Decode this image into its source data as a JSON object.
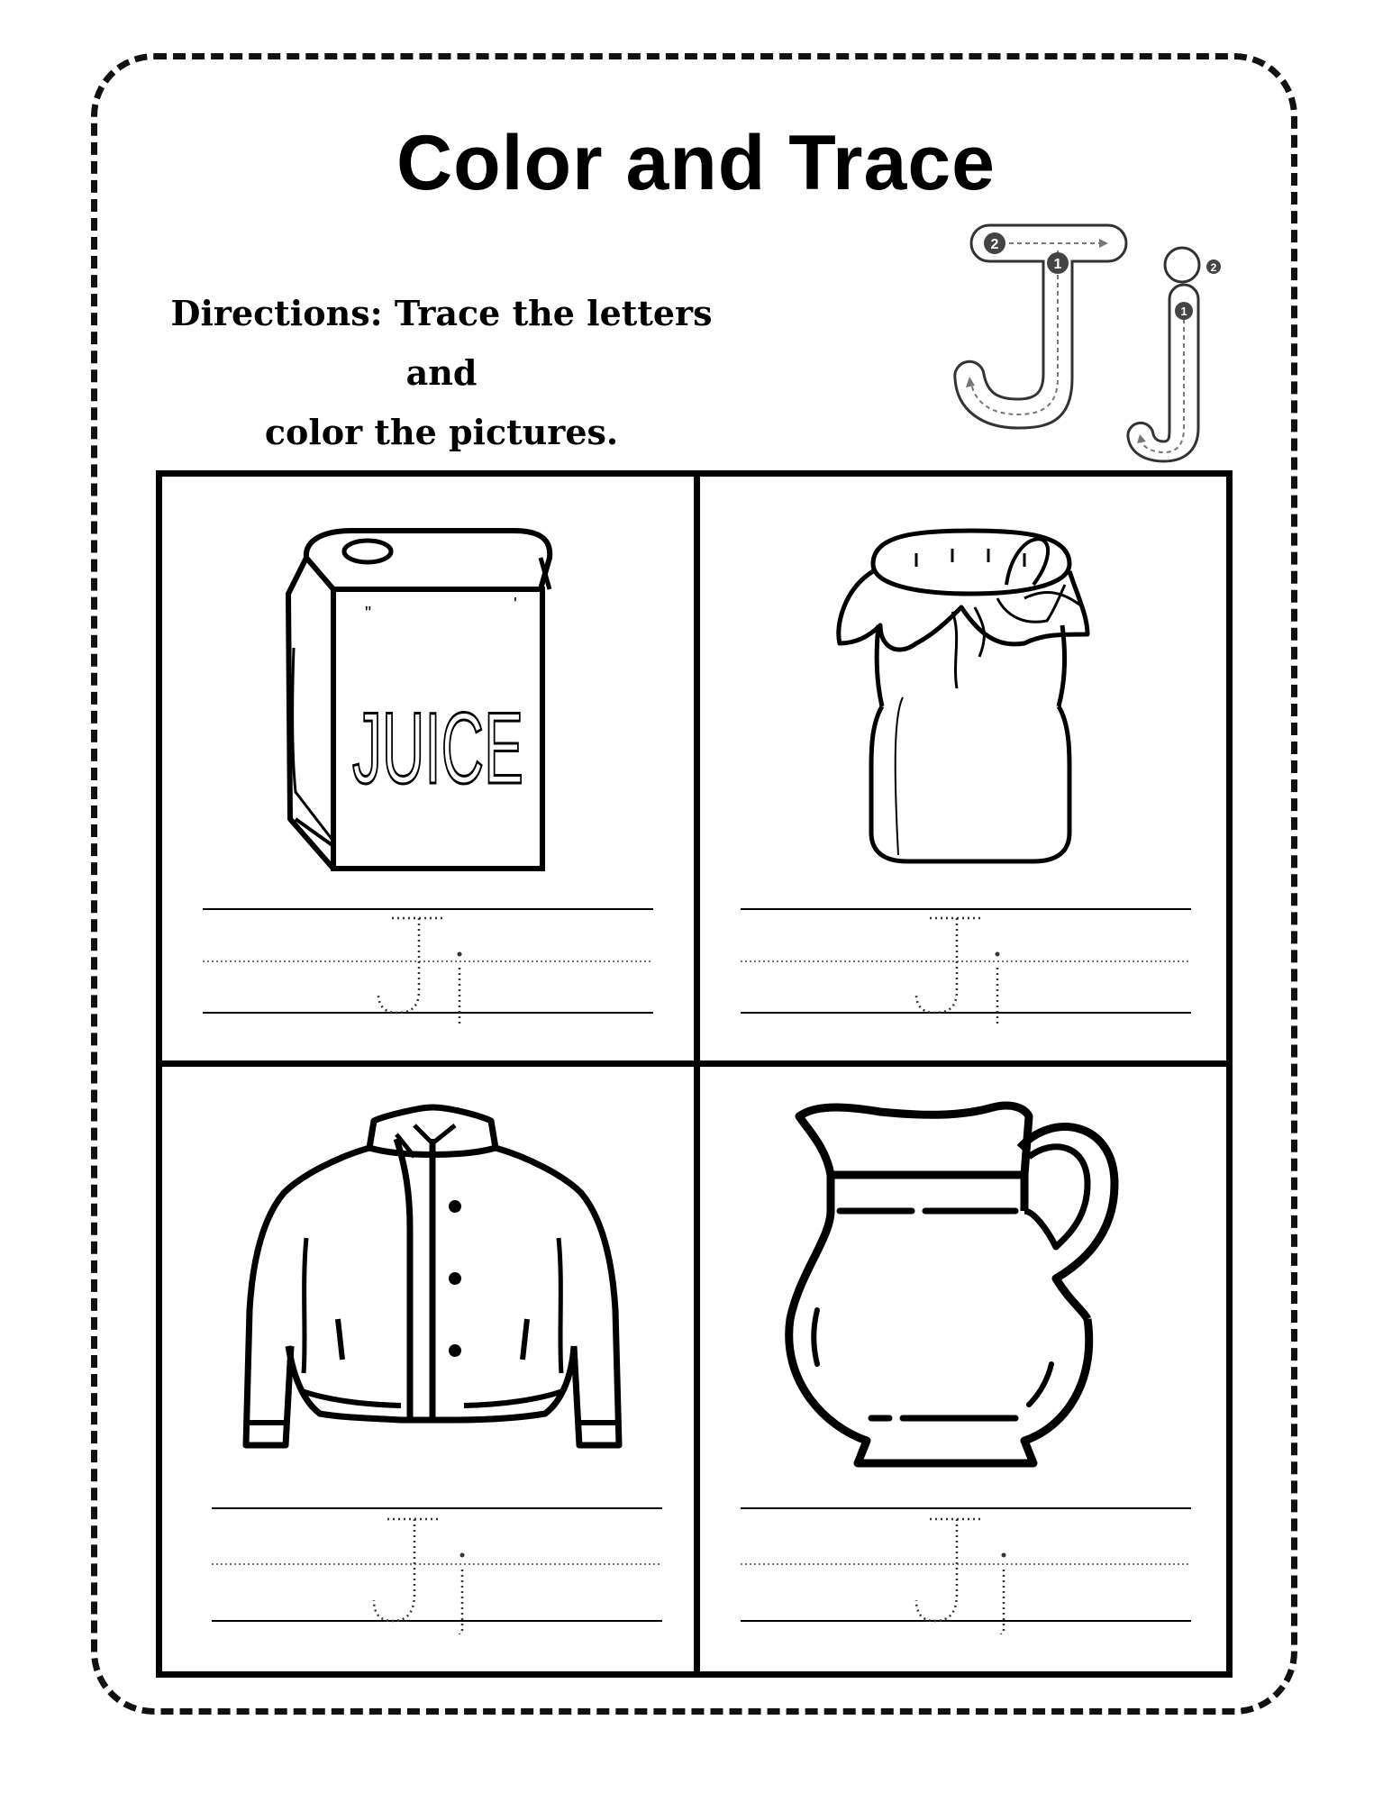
{
  "worksheet": {
    "title": "Color and Trace",
    "directions_line1": "Directions: Trace the letters and",
    "directions_line2": "color the pictures.",
    "guide_letters": {
      "uppercase": "J",
      "lowercase": "j",
      "uppercase_steps": [
        "1",
        "2"
      ],
      "lowercase_steps": [
        "1",
        "2"
      ]
    },
    "cells": [
      {
        "picture": "juice-box",
        "label_on_picture": "JUICE",
        "trace_letters": "Jj"
      },
      {
        "picture": "jam-jar",
        "trace_letters": "Jj"
      },
      {
        "picture": "jacket",
        "trace_letters": "Jj"
      },
      {
        "picture": "jug",
        "trace_letters": "Jj"
      }
    ]
  }
}
